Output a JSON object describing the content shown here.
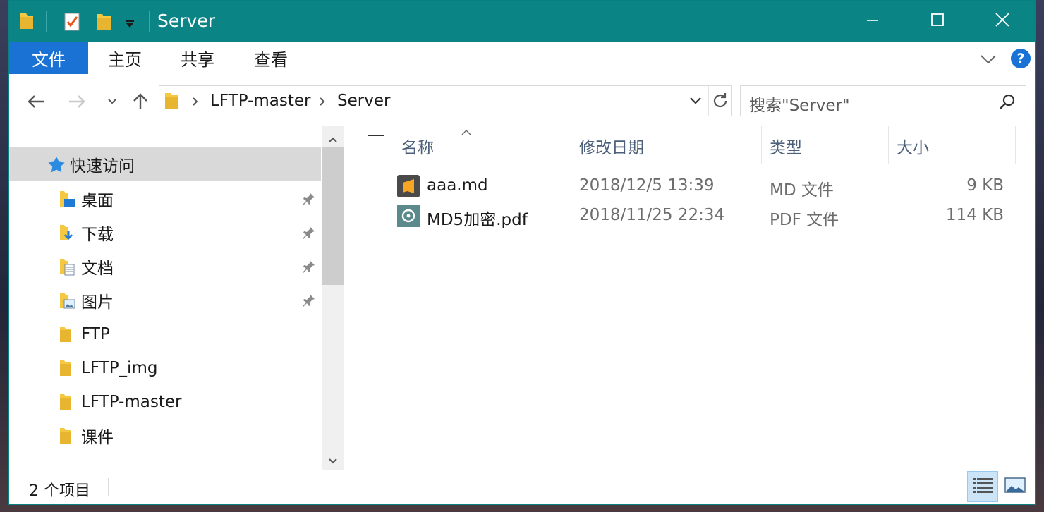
{
  "window": {
    "title": "Server",
    "colors": {
      "titlebar": "#0b8485",
      "accent": "#1a73d4",
      "selected": "#d9d9d9"
    },
    "quick_access_icons": [
      "folder-icon",
      "properties-icon",
      "new-folder-icon",
      "customize-dropdown-icon"
    ],
    "controls": [
      "minimize-icon",
      "maximize-icon",
      "close-icon"
    ]
  },
  "ribbon": {
    "file_tab": "文件",
    "tabs": [
      "主页",
      "共享",
      "查看"
    ],
    "help": "?"
  },
  "nav": {
    "breadcrumb": [
      "LFTP-master",
      "Server"
    ],
    "search_placeholder": "搜索\"Server\""
  },
  "sidebar": {
    "quick_access": "快速访问",
    "items": [
      {
        "label": "桌面",
        "icon": "desktop-folder-icon",
        "pinned": true
      },
      {
        "label": "下载",
        "icon": "downloads-folder-icon",
        "pinned": true
      },
      {
        "label": "文档",
        "icon": "documents-folder-icon",
        "pinned": true
      },
      {
        "label": "图片",
        "icon": "pictures-folder-icon",
        "pinned": true
      },
      {
        "label": "FTP",
        "icon": "folder-icon",
        "pinned": false
      },
      {
        "label": "LFTP_img",
        "icon": "folder-icon",
        "pinned": false
      },
      {
        "label": "LFTP-master",
        "icon": "folder-icon",
        "pinned": false
      },
      {
        "label": "课件",
        "icon": "folder-icon",
        "pinned": false
      }
    ]
  },
  "file_list": {
    "columns": [
      "名称",
      "修改日期",
      "类型",
      "大小"
    ],
    "rows": [
      {
        "name": "aaa.md",
        "modified": "2018/12/5 13:39",
        "type": "MD 文件",
        "size": "9 KB",
        "icon": "sublime-text-icon"
      },
      {
        "name": "MD5加密.pdf",
        "modified": "2018/11/25 22:34",
        "type": "PDF 文件",
        "size": "114 KB",
        "icon": "pdf-file-icon"
      }
    ]
  },
  "status": {
    "count": "2 个项目"
  }
}
